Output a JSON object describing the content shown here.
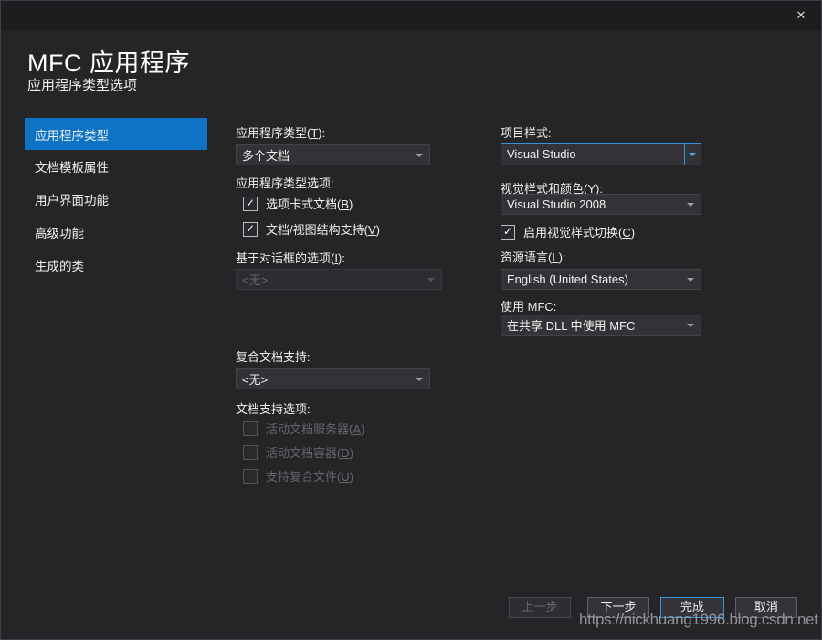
{
  "window": {
    "close_icon": "✕"
  },
  "header": {
    "title": "MFC 应用程序",
    "subtitle": "应用程序类型选项"
  },
  "sidebar": {
    "items": [
      {
        "label": "应用程序类型",
        "selected": true
      },
      {
        "label": "文档模板属性",
        "selected": false
      },
      {
        "label": "用户界面功能",
        "selected": false
      },
      {
        "label": "高级功能",
        "selected": false
      },
      {
        "label": "生成的类",
        "selected": false
      }
    ]
  },
  "middle": {
    "app_type_label": "应用程序类型(T):",
    "app_type_value": "多个文档",
    "app_type_options_label": "应用程序类型选项:",
    "checkboxes": [
      {
        "label": "选项卡式文档(B)",
        "checked": true,
        "disabled": false
      },
      {
        "label": "文档/视图结构支持(V)",
        "checked": true,
        "disabled": false
      }
    ],
    "dialog_based_label": "基于对话框的选项(I):",
    "dialog_based_value": "<无>",
    "compound_doc_label": "复合文档支持:",
    "compound_doc_value": "<无>",
    "doc_support_label": "文档支持选项:",
    "doc_support_checkboxes": [
      {
        "label": "活动文档服务器(A)",
        "checked": false,
        "disabled": true
      },
      {
        "label": "活动文档容器(D)",
        "checked": false,
        "disabled": true
      },
      {
        "label": "支持复合文件(U)",
        "checked": false,
        "disabled": true
      }
    ]
  },
  "right": {
    "project_style_label": "项目样式:",
    "project_style_value": "Visual Studio",
    "visual_style_label": "视觉样式和颜色(Y):",
    "visual_style_value": "Visual Studio 2008",
    "enable_switch_checkbox": {
      "label": "启用视觉样式切换(C)",
      "checked": true
    },
    "resource_lang_label": "资源语言(L):",
    "resource_lang_value": "English (United States)",
    "use_mfc_label": "使用 MFC:",
    "use_mfc_value": "在共享 DLL 中使用 MFC"
  },
  "footer": {
    "back_label": "上一步",
    "next_label": "下一步",
    "finish_label": "完成",
    "cancel_label": "取消"
  },
  "watermark": "https://nickhuang1996.blog.csdn.net",
  "colors": {
    "accent_selected": "#0e73c4",
    "focus_border": "#3393df",
    "dialog_bg": "#252528",
    "titlebar_bg": "#1d1d20",
    "combo_bg": "#333337"
  },
  "glyphs": {
    "check": "✓"
  }
}
